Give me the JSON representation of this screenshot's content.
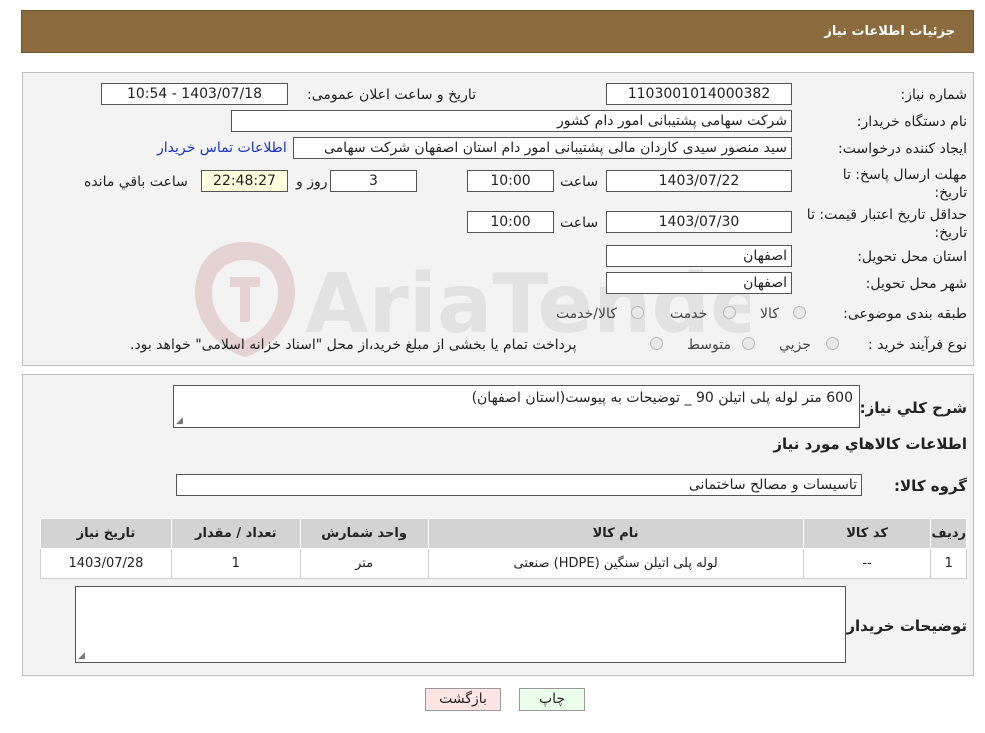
{
  "header": {
    "title": "جزئیات اطلاعات نیاز"
  },
  "form": {
    "need_number_label": "شماره نیاز:",
    "need_number": "1103001014000382",
    "announce_label": "تاریخ و ساعت اعلان عمومی:",
    "announce_value": "1403/07/18 - 10:54",
    "buyer_org_label": "نام دستگاه خریدار:",
    "buyer_org": "شرکت سهامی پشتیبانی امور دام کشور",
    "creator_label": "ایجاد کننده درخواست:",
    "creator": "سید منصور سیدی کاردان مالی پشتیبانی امور دام استان اصفهان شرکت سهامی",
    "contact_link": "اطلاعات تماس خریدار",
    "deadline_label": "مهلت ارسال پاسخ: تا تاریخ:",
    "deadline_date": "1403/07/22",
    "time_label": "ساعت",
    "deadline_time": "10:00",
    "days_value": "3",
    "days_label": "روز و",
    "remaining_time": "22:48:27",
    "remaining_label": "ساعت باقي مانده",
    "min_validity_label": "حداقل تاریخ اعتبار قیمت: تا تاریخ:",
    "validity_date": "1403/07/30",
    "validity_time": "10:00",
    "province_label": "استان محل تحویل:",
    "province": "اصفهان",
    "city_label": "شهر محل تحویل:",
    "city": "اصفهان",
    "category_label": "طبقه بندی موضوعی:",
    "category_options": [
      "کالا",
      "خدمت",
      "کالا/خدمت"
    ],
    "process_label": "نوع فرآیند خرید :",
    "process_options": [
      "جزیي",
      "متوسط"
    ],
    "payment_note": "پرداخت تمام یا بخشی از مبلغ خرید،از محل \"اسناد خزانه اسلامی\" خواهد بود."
  },
  "details": {
    "description_label": "شرح كلي نياز:",
    "description": "600 متر لوله پلی اتیلن 90 _ توضیحات به پیوست(استان اصفهان)",
    "goods_info_title": "اطلاعات كالاهاي مورد نياز",
    "goods_group_label": "گروه كالا:",
    "goods_group": "تاسیسات و مصالح ساختمانی",
    "table": {
      "headers": [
        "ردیف",
        "کد کالا",
        "نام کالا",
        "واحد شمارش",
        "تعداد / مقدار",
        "تاریخ نیاز"
      ],
      "rows": [
        [
          "1",
          "--",
          "لوله پلی اتیلن سنگین (HDPE) صنعتی",
          "متر",
          "1",
          "1403/07/28"
        ]
      ]
    },
    "buyer_notes_label": "توضيحات خريدار:",
    "buyer_notes": ""
  },
  "buttons": {
    "print": "چاپ",
    "back": "بازگشت"
  },
  "watermark": {
    "text": "AriaTender.neT"
  }
}
